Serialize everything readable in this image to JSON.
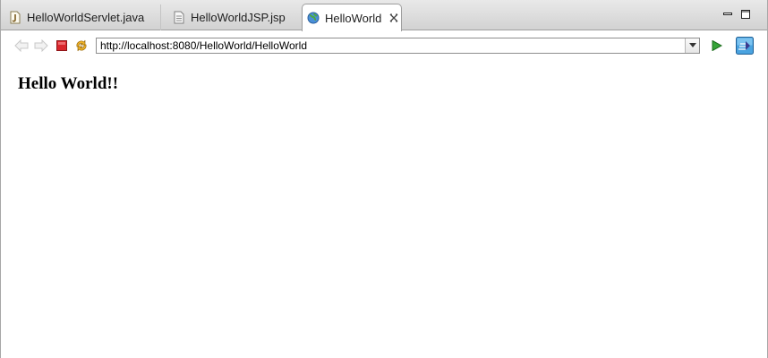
{
  "tabs": [
    {
      "label": "HelloWorldServlet.java",
      "icon": "java-file-icon",
      "active": false
    },
    {
      "label": "HelloWorldJSP.jsp",
      "icon": "jsp-file-icon",
      "active": false
    },
    {
      "label": "HelloWorld",
      "icon": "globe-icon",
      "active": true
    }
  ],
  "window_controls": {
    "minimize_icon": "minimize-icon",
    "maximize_icon": "maximize-icon"
  },
  "toolbar": {
    "url": "http://localhost:8080/HelloWorld/HelloWorld",
    "icons": [
      "back-arrow-icon",
      "forward-arrow-icon",
      "stop-icon",
      "refresh-icon",
      "go-icon",
      "external-browser-icon"
    ]
  },
  "page": {
    "heading": "Hello World!!"
  },
  "colors": {
    "stop": "#d9262c",
    "go": "#35a437",
    "tabstrip": "#dcdcdc"
  }
}
